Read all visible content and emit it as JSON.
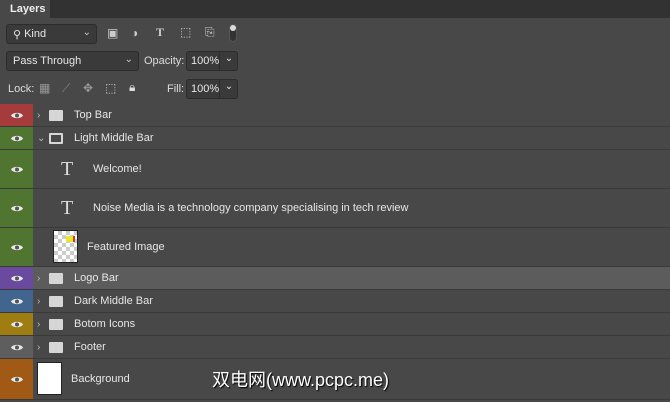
{
  "panel": {
    "tab": "Layers"
  },
  "filter": {
    "kind_label": "Kind"
  },
  "blend": {
    "mode": "Pass Through",
    "opacity_label": "Opacity:",
    "opacity": "100%"
  },
  "lock": {
    "label": "Lock:",
    "fill_label": "Fill:",
    "fill": "100%"
  },
  "layers": [
    {
      "name": "Top Bar",
      "type": "group",
      "color": "#a63b3b",
      "expanded": false
    },
    {
      "name": "Light Middle Bar",
      "type": "group",
      "color": "#4f7530",
      "expanded": true
    },
    {
      "name": "Welcome!",
      "type": "text",
      "color": "#4f7530"
    },
    {
      "name": "Noise Media is a technology company specialising in tech review",
      "type": "text",
      "color": "#4f7530"
    },
    {
      "name": "Featured Image",
      "type": "image",
      "color": "#4f7530"
    },
    {
      "name": "Logo Bar",
      "type": "group",
      "color": "#6a4a9e",
      "selected": true
    },
    {
      "name": "Dark Middle Bar",
      "type": "group",
      "color": "#42658f"
    },
    {
      "name": "Botom Icons",
      "type": "group",
      "color": "#a07d10"
    },
    {
      "name": "Footer",
      "type": "group",
      "color": "#5e5e5e"
    },
    {
      "name": "Background",
      "type": "background",
      "color": "#a05a15"
    }
  ],
  "watermark": "双电网(www.pcpc.me)"
}
